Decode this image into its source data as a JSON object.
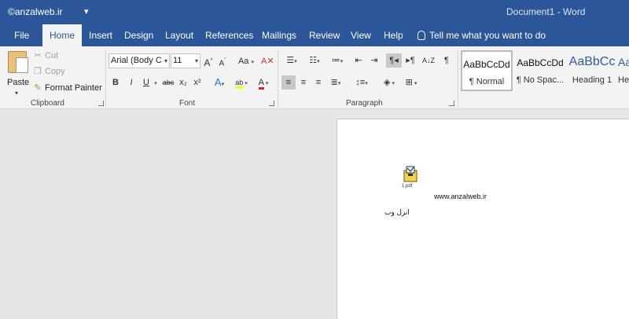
{
  "titlebar": {
    "watermark": "©anzalweb.ir",
    "qat_customize": "▾",
    "document_title": "Document1 - Word"
  },
  "tabs": [
    {
      "label": "File"
    },
    {
      "label": "Home"
    },
    {
      "label": "Insert"
    },
    {
      "label": "Design"
    },
    {
      "label": "Layout"
    },
    {
      "label": "References"
    },
    {
      "label": "Mailings"
    },
    {
      "label": "Review"
    },
    {
      "label": "View"
    },
    {
      "label": "Help"
    }
  ],
  "tellme": "Tell me what you want to do",
  "clipboard": {
    "paste": "Paste",
    "cut": "Cut",
    "copy": "Copy",
    "format_painter": "Format Painter",
    "group_label": "Clipboard"
  },
  "font": {
    "name": "Arial (Body C",
    "size": "11",
    "grow": "A",
    "shrink": "A",
    "change_case": "Aa",
    "bold": "B",
    "italic": "I",
    "underline": "U",
    "strikethrough": "abc",
    "subscript": "x₂",
    "superscript": "x²",
    "text_effects": "A",
    "highlight": "ab",
    "font_color": "A",
    "group_label": "Font"
  },
  "paragraph": {
    "group_label": "Paragraph",
    "sort": "A↓Z",
    "show_marks": "¶"
  },
  "styles": [
    {
      "sample": "AaBbCcDd",
      "name": "¶ Normal"
    },
    {
      "sample": "AaBbCcDd",
      "name": "¶ No Spac..."
    },
    {
      "sample": "AaBbCc",
      "name": "Heading 1"
    },
    {
      "sample": "AaB",
      "name": "He"
    }
  ],
  "document": {
    "attachment_name": "1.pdf",
    "site_text": "www.anzalweb.ir",
    "persian_text": "انزل وب"
  },
  "colors": {
    "brand": "#2b579a",
    "highlight": "#ffff00",
    "font_color": "#e02020"
  }
}
